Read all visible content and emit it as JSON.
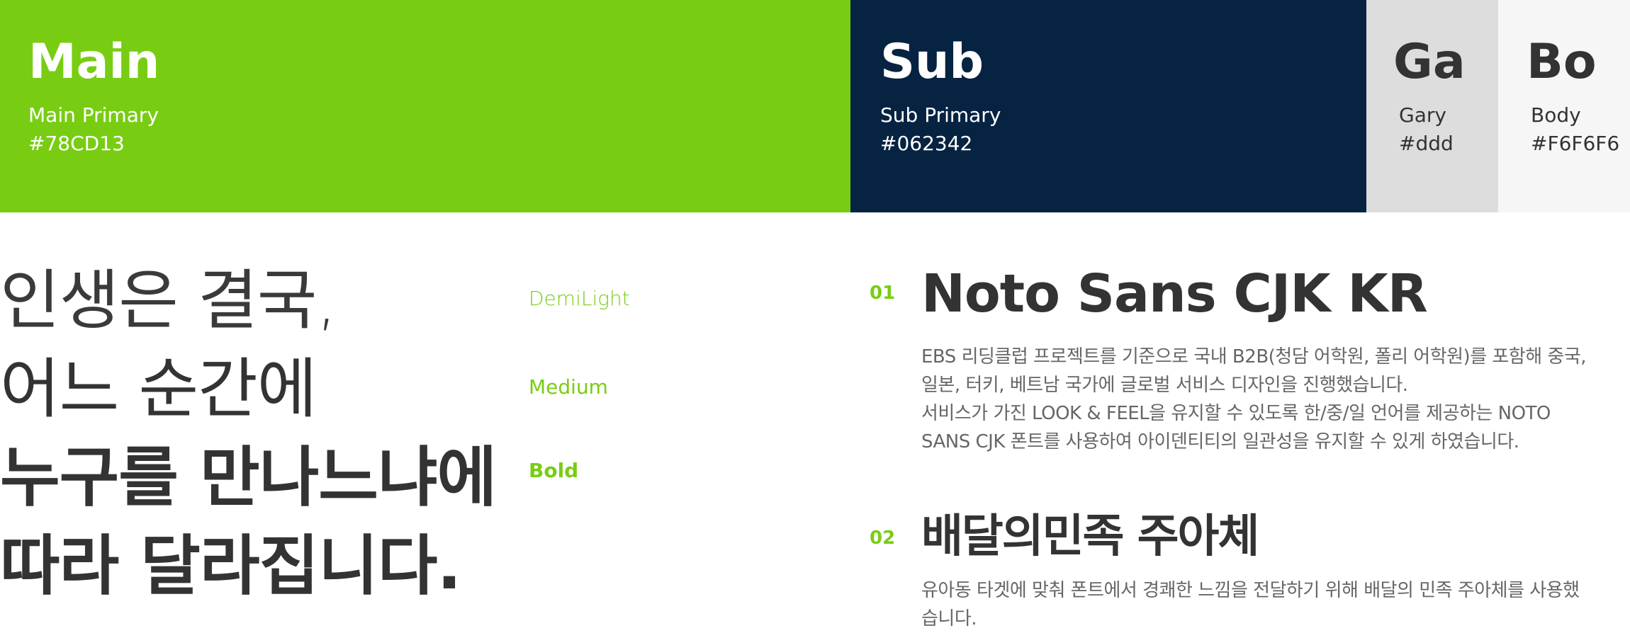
{
  "swatches": {
    "main": {
      "title": "Main",
      "label": "Main Primary",
      "hex": "#78CD13",
      "color": "#78CD13"
    },
    "sub": {
      "title": "Sub",
      "label": "Sub Primary",
      "hex": "#062342",
      "color": "#062342"
    },
    "gray": {
      "title": "Ga",
      "label": "Gary",
      "hex": "#ddd",
      "color": "#dddddd"
    },
    "body": {
      "title": "Bo",
      "label": "Body",
      "hex": "#F6F6F6",
      "color": "#F6F6F6"
    }
  },
  "slogan": {
    "line1": "인생은 결국,",
    "line2": "어느 순간에",
    "line3": "누구를 만나느냐에",
    "line4": "따라 달라집니다."
  },
  "weights": {
    "demilight": "DemiLight",
    "medium": "Medium",
    "bold": "Bold"
  },
  "fonts": [
    {
      "number": "01",
      "name": "Noto Sans CJK KR",
      "description": [
        "EBS 리딩클럽 프로젝트를 기준으로 국내 B2B(청담 어학원, 폴리 어학원)를 포함해 중국,",
        "일본, 터키,  베트남 국가에 글로벌 서비스 디자인을 진행했습니다.",
        "서비스가 가진 LOOK & FEEL을 유지할 수 있도록 한/중/일 언어를 제공하는 NOTO",
        "SANS CJK 폰트를 사용하여 아이덴티티의 일관성을 유지할 수 있게 하였습니다."
      ]
    },
    {
      "number": "02",
      "name": "배달의민족 주아체",
      "description": [
        "유아동 타겟에 맞춰 폰트에서 경쾌한 느낌을 전달하기 위해 배달의 민족 주아체를 사용했",
        "습니다."
      ]
    }
  ],
  "colors": {
    "accent": "#78CD13",
    "navy": "#062342",
    "text": "#333333",
    "muted": "#666666"
  }
}
